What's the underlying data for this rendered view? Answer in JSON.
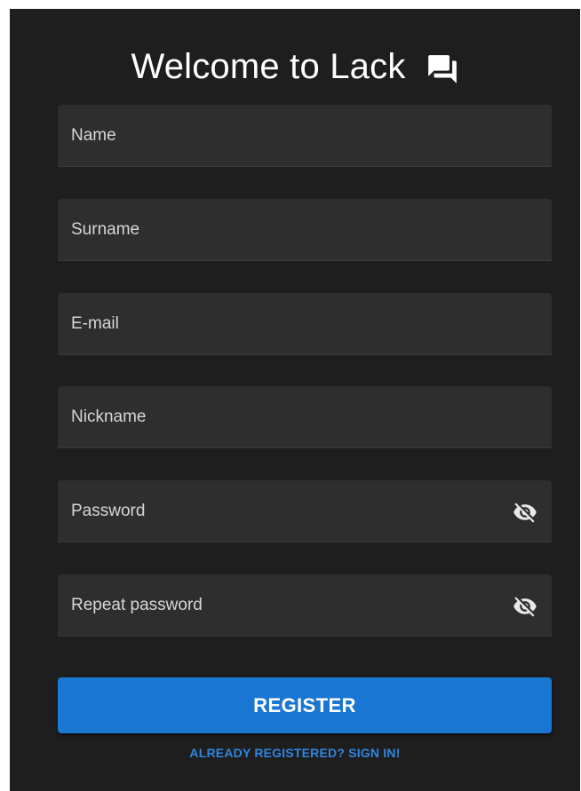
{
  "header": {
    "title": "Welcome to Lack",
    "icon": "forum-icon"
  },
  "form": {
    "fields": [
      {
        "placeholder": "Name",
        "value": "",
        "type": "text"
      },
      {
        "placeholder": "Surname",
        "value": "",
        "type": "text"
      },
      {
        "placeholder": "E-mail",
        "value": "",
        "type": "email"
      },
      {
        "placeholder": "Nickname",
        "value": "",
        "type": "text"
      },
      {
        "placeholder": "Password",
        "value": "",
        "type": "password",
        "icon": "visibility-off-icon"
      },
      {
        "placeholder": "Repeat password",
        "value": "",
        "type": "password",
        "icon": "visibility-off-icon"
      }
    ],
    "register_label": "REGISTER",
    "signin_label": "ALREADY REGISTERED? SIGN IN!"
  },
  "colors": {
    "background": "#1e1e1e",
    "field_background": "#2e2e2e",
    "accent": "#1976d2",
    "link": "#2f86e0"
  }
}
